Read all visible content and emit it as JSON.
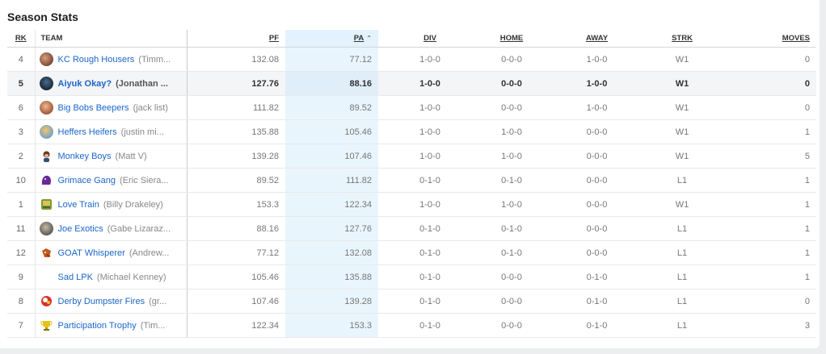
{
  "title": "Season Stats",
  "columns": {
    "rk": "RK",
    "team": "TEAM",
    "pf": "PF",
    "pa": "PA",
    "div": "DIV",
    "home": "HOME",
    "away": "AWAY",
    "strk": "STRK",
    "moves": "MOVES"
  },
  "colors": {
    "link": "#1b66c9",
    "sort_column_bg": "#e9f5fd",
    "highlight_row_bg": "#f4f5f6"
  },
  "rows": [
    {
      "rk": "4",
      "team": "KC Rough Housers",
      "owner": "(Timm...",
      "pf": "132.08",
      "pa": "77.12",
      "div": "1-0-0",
      "home": "0-0-0",
      "away": "1-0-0",
      "strk": "W1",
      "moves": "0",
      "avatar": "team-logo-icon"
    },
    {
      "rk": "5",
      "team": "Aiyuk Okay?",
      "owner": "(Jonathan ...",
      "pf": "127.76",
      "pa": "88.16",
      "div": "1-0-0",
      "home": "0-0-0",
      "away": "1-0-0",
      "strk": "W1",
      "moves": "0",
      "avatar": "team-logo-icon"
    },
    {
      "rk": "6",
      "team": "Big Bobs Beepers",
      "owner": "(jack list)",
      "pf": "111.82",
      "pa": "89.52",
      "div": "1-0-0",
      "home": "0-0-0",
      "away": "1-0-0",
      "strk": "W1",
      "moves": "0",
      "avatar": "team-logo-icon"
    },
    {
      "rk": "3",
      "team": "Heffers Heifers",
      "owner": "(justin mi...",
      "pf": "135.88",
      "pa": "105.46",
      "div": "1-0-0",
      "home": "1-0-0",
      "away": "0-0-0",
      "strk": "W1",
      "moves": "1",
      "avatar": "team-logo-icon"
    },
    {
      "rk": "2",
      "team": "Monkey Boys",
      "owner": "(Matt V)",
      "pf": "139.28",
      "pa": "107.46",
      "div": "1-0-0",
      "home": "1-0-0",
      "away": "0-0-0",
      "strk": "W1",
      "moves": "5",
      "avatar": "team-logo-icon"
    },
    {
      "rk": "10",
      "team": "Grimace Gang",
      "owner": "(Eric Siera...",
      "pf": "89.52",
      "pa": "111.82",
      "div": "0-1-0",
      "home": "0-1-0",
      "away": "0-0-0",
      "strk": "L1",
      "moves": "1",
      "avatar": "team-logo-icon"
    },
    {
      "rk": "1",
      "team": "Love Train",
      "owner": "(Billy Drakeley)",
      "pf": "153.3",
      "pa": "122.34",
      "div": "1-0-0",
      "home": "1-0-0",
      "away": "0-0-0",
      "strk": "W1",
      "moves": "1",
      "avatar": "team-logo-icon"
    },
    {
      "rk": "11",
      "team": "Joe Exotics",
      "owner": "(Gabe Lizaraz...",
      "pf": "88.16",
      "pa": "127.76",
      "div": "0-1-0",
      "home": "0-1-0",
      "away": "0-0-0",
      "strk": "L1",
      "moves": "1",
      "avatar": "team-logo-icon"
    },
    {
      "rk": "12",
      "team": "GOAT Whisperer",
      "owner": "(Andrew...",
      "pf": "77.12",
      "pa": "132.08",
      "div": "0-1-0",
      "home": "0-1-0",
      "away": "0-0-0",
      "strk": "L1",
      "moves": "1",
      "avatar": "team-logo-icon"
    },
    {
      "rk": "9",
      "team": "Sad LPK",
      "owner": "(Michael Kenney)",
      "pf": "105.46",
      "pa": "135.88",
      "div": "0-1-0",
      "home": "0-0-0",
      "away": "0-1-0",
      "strk": "L1",
      "moves": "1",
      "avatar": ""
    },
    {
      "rk": "8",
      "team": "Derby Dumpster Fires",
      "owner": "(gr...",
      "pf": "107.46",
      "pa": "139.28",
      "div": "0-1-0",
      "home": "0-0-0",
      "away": "0-1-0",
      "strk": "L1",
      "moves": "0",
      "avatar": "team-logo-icon"
    },
    {
      "rk": "7",
      "team": "Participation Trophy",
      "owner": "(Tim...",
      "pf": "122.34",
      "pa": "153.3",
      "div": "0-1-0",
      "home": "0-0-0",
      "away": "0-1-0",
      "strk": "L1",
      "moves": "3",
      "avatar": "team-logo-icon"
    }
  ]
}
